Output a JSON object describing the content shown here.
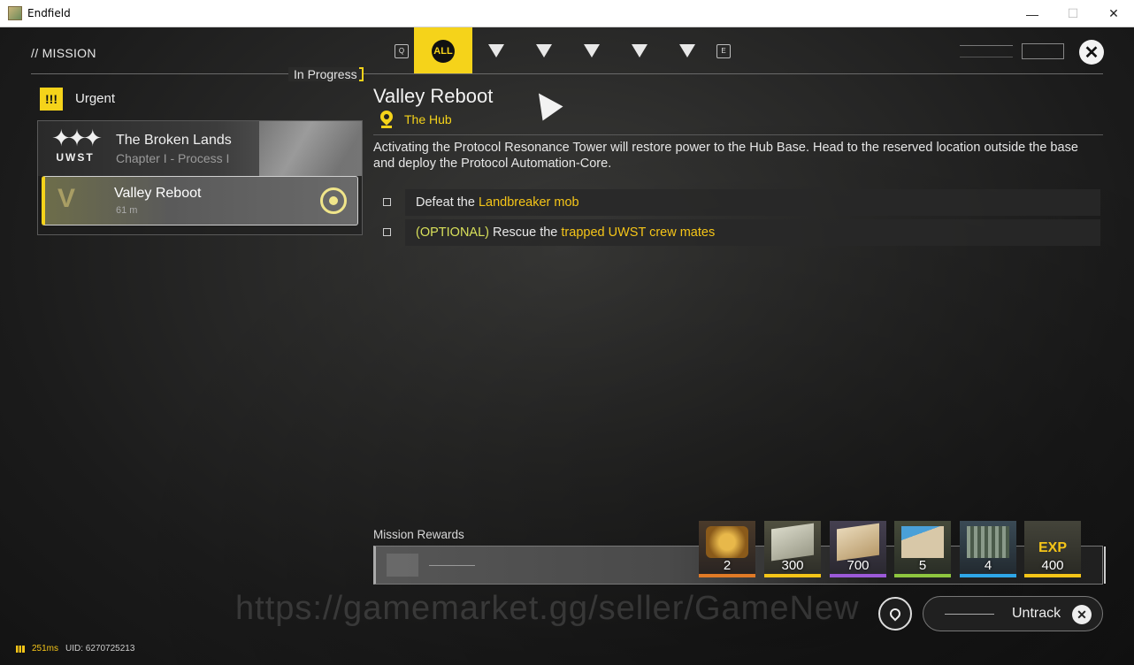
{
  "window": {
    "title": "Endfield",
    "minimize": "—",
    "maximize": "☐",
    "close": "✕"
  },
  "header": {
    "section": "// MISSION",
    "in_progress": "In Progress"
  },
  "tabs": {
    "key_left": "Q",
    "all_label": "ALL",
    "key_right": "E",
    "category_icons": [
      "main-mission-icon",
      "side-mission-icon",
      "alert-mission-icon",
      "event-mission-icon",
      "misc-mission-icon"
    ]
  },
  "list": {
    "group_label": "Urgent",
    "group_icon": "!!!",
    "chapter": {
      "logo": "UWST",
      "title": "The Broken Lands",
      "subtitle": "Chapter I - Process I"
    },
    "missions": [
      {
        "title": "Valley Reboot",
        "distance": "61 m",
        "tracked": true
      }
    ]
  },
  "detail": {
    "title": "Valley Reboot",
    "location": "The Hub",
    "description": "Activating the Protocol Resonance Tower will restore power to the Hub Base. Head to the reserved location outside the base and deploy the Protocol Automation-Core.",
    "objectives": [
      {
        "prefix": "",
        "pre": "Defeat the ",
        "target": "Landbreaker mob"
      },
      {
        "prefix": "(OPTIONAL)",
        "pre": " Rescue the ",
        "target": "trapped UWST crew mates"
      }
    ]
  },
  "rewards": {
    "label": "Mission Rewards",
    "items": [
      {
        "icon": "gem-crate-icon",
        "qty": "2",
        "rarity": "orange"
      },
      {
        "icon": "ticket-bundle-icon",
        "qty": "300",
        "rarity": "yellow"
      },
      {
        "icon": "voucher-icon",
        "qty": "700",
        "rarity": "purple"
      },
      {
        "icon": "exp-card-icon",
        "qty": "5",
        "rarity": "green"
      },
      {
        "icon": "component-icon",
        "qty": "4",
        "rarity": "blue"
      },
      {
        "icon": "exp-icon",
        "qty": "400",
        "rarity": "gold",
        "art_text": "EXP"
      }
    ]
  },
  "controls": {
    "untrack_label": "Untrack"
  },
  "watermark": "https://gamemarket.gg/seller/GameNew",
  "status": {
    "ping": "251ms",
    "uid": "UID: 6270725213"
  },
  "colors": {
    "accent": "#f5d31a",
    "highlight": "#f5c518",
    "optional": "#d8e05a"
  }
}
